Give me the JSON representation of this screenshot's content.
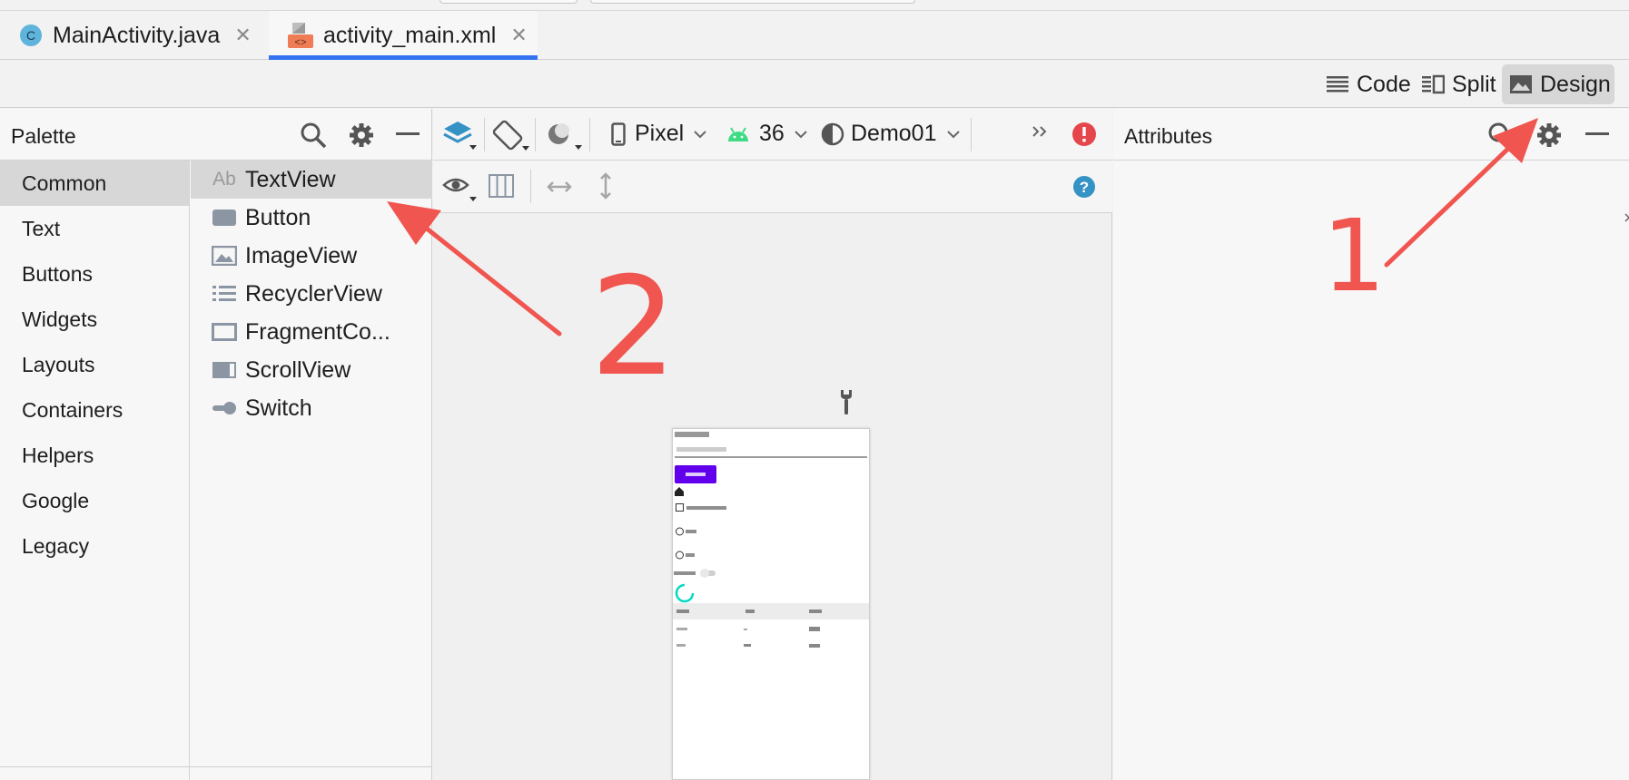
{
  "tabs": [
    {
      "label": "MainActivity.java",
      "icon": "java-class-icon",
      "active": false
    },
    {
      "label": "activity_main.xml",
      "icon": "xml-layout-icon",
      "active": true
    }
  ],
  "view_modes": [
    {
      "label": "Code",
      "icon": "code-view-icon",
      "selected": false
    },
    {
      "label": "Split",
      "icon": "split-view-icon",
      "selected": false
    },
    {
      "label": "Design",
      "icon": "design-view-icon",
      "selected": true
    }
  ],
  "palette": {
    "title": "Palette",
    "categories": [
      "Common",
      "Text",
      "Buttons",
      "Widgets",
      "Layouts",
      "Containers",
      "Helpers",
      "Google",
      "Legacy"
    ],
    "selected_category": "Common",
    "components": [
      {
        "label": "TextView",
        "icon": "textview-icon",
        "prefix": "Ab"
      },
      {
        "label": "Button",
        "icon": "button-icon"
      },
      {
        "label": "ImageView",
        "icon": "imageview-icon"
      },
      {
        "label": "RecyclerView",
        "icon": "recyclerview-icon"
      },
      {
        "label": "FragmentCo...",
        "icon": "fragment-container-icon"
      },
      {
        "label": "ScrollView",
        "icon": "scrollview-icon"
      },
      {
        "label": "Switch",
        "icon": "switch-icon"
      }
    ]
  },
  "design_toolbar": {
    "device": "Pixel",
    "api_level": "36",
    "theme": "Demo01"
  },
  "attributes": {
    "title": "Attributes"
  },
  "annotations": {
    "number_1": "1",
    "number_2": "2",
    "color": "#f0554f"
  },
  "colors": {
    "accent": "#3574f0",
    "android_green": "#3ddc84",
    "error_red": "#e5464b",
    "help_blue": "#3592c4",
    "preview_button": "#6200ee",
    "preview_progress": "#03dac5"
  }
}
